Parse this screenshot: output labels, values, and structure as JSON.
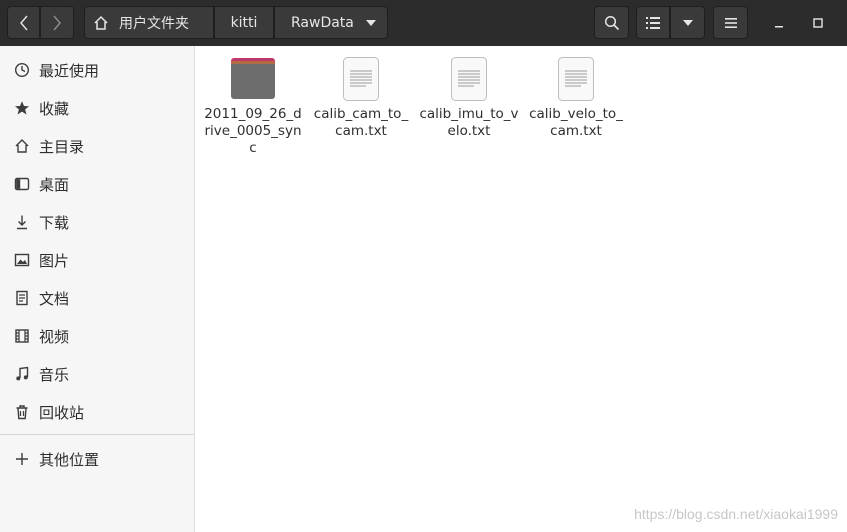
{
  "toolbar": {
    "breadcrumb": [
      "用户文件夹",
      "kitti",
      "RawData"
    ]
  },
  "sidebar": {
    "items": [
      {
        "label": "最近使用",
        "icon": "clock-icon"
      },
      {
        "label": "收藏",
        "icon": "star-icon"
      },
      {
        "label": "主目录",
        "icon": "home-icon"
      },
      {
        "label": "桌面",
        "icon": "desktop-icon"
      },
      {
        "label": "下载",
        "icon": "download-icon"
      },
      {
        "label": "图片",
        "icon": "pictures-icon"
      },
      {
        "label": "文档",
        "icon": "documents-icon"
      },
      {
        "label": "视频",
        "icon": "video-icon"
      },
      {
        "label": "音乐",
        "icon": "music-icon"
      },
      {
        "label": "回收站",
        "icon": "trash-icon"
      }
    ],
    "other_locations": {
      "label": "其他位置",
      "icon": "plus-icon"
    }
  },
  "files": [
    {
      "name": "2011_09_26_drive_0005_sync",
      "type": "folder"
    },
    {
      "name": "calib_cam_to_cam.txt",
      "type": "text"
    },
    {
      "name": "calib_imu_to_velo.txt",
      "type": "text"
    },
    {
      "name": "calib_velo_to_cam.txt",
      "type": "text"
    }
  ],
  "colors": {
    "header": "#2c2c2c",
    "sidebar": "#f6f6f6",
    "folder_top": "#c0386a",
    "folder_body": "#6d6d6d"
  },
  "watermark": "https://blog.csdn.net/xiaokai1999"
}
